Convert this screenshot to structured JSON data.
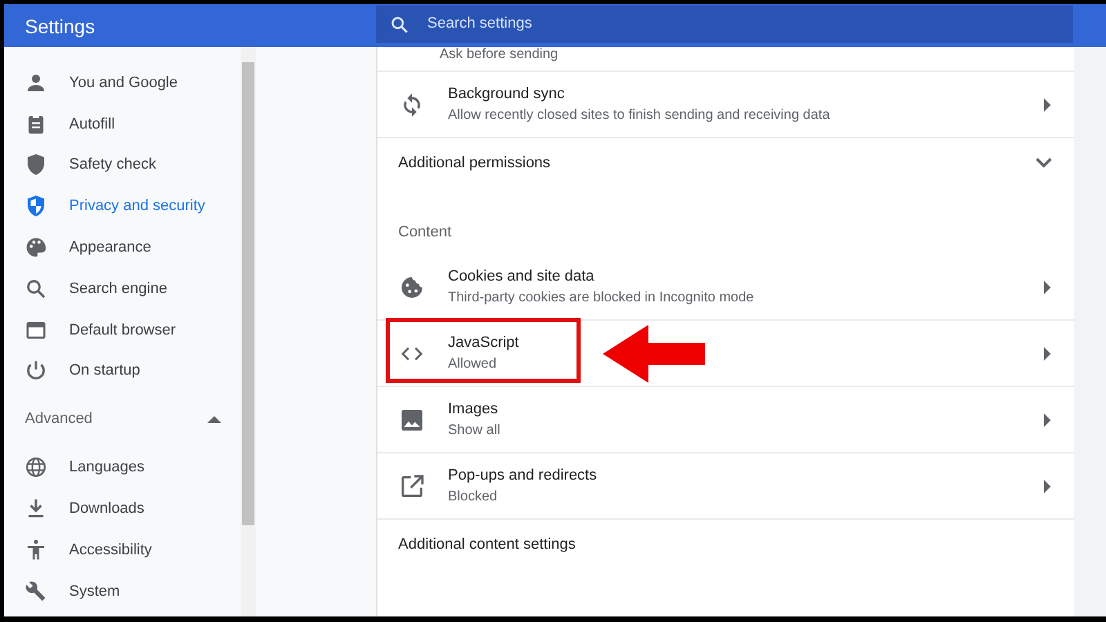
{
  "header": {
    "title": "Settings",
    "search": {
      "placeholder": "Search settings"
    }
  },
  "sidebar": {
    "items": [
      {
        "label": "You and Google",
        "selected": false
      },
      {
        "label": "Autofill",
        "selected": false
      },
      {
        "label": "Safety check",
        "selected": false
      },
      {
        "label": "Privacy and security",
        "selected": true
      },
      {
        "label": "Appearance",
        "selected": false
      },
      {
        "label": "Search engine",
        "selected": false
      },
      {
        "label": "Default browser",
        "selected": false
      },
      {
        "label": "On startup",
        "selected": false
      }
    ],
    "advanced": {
      "label": "Advanced",
      "expanded": true,
      "items": [
        {
          "label": "Languages",
          "selected": false
        },
        {
          "label": "Downloads",
          "selected": false
        },
        {
          "label": "Accessibility",
          "selected": false
        },
        {
          "label": "System",
          "selected": false
        }
      ]
    }
  },
  "main": {
    "rows": [
      {
        "kind": "subtext",
        "text": "Ask before sending"
      },
      {
        "kind": "item",
        "title": "Background sync",
        "subtitle": "Allow recently closed sites to finish sending and receiving data",
        "highlighted": false
      },
      {
        "kind": "expander",
        "title": "Additional permissions",
        "expanded": false
      },
      {
        "kind": "heading",
        "title": "Content"
      },
      {
        "kind": "item",
        "title": "Cookies and site data",
        "subtitle": "Third-party cookies are blocked in Incognito mode",
        "highlighted": false
      },
      {
        "kind": "item",
        "title": "JavaScript",
        "subtitle": "Allowed",
        "highlighted": true
      },
      {
        "kind": "item",
        "title": "Images",
        "subtitle": "Show all",
        "highlighted": false
      },
      {
        "kind": "item",
        "title": "Pop-ups and redirects",
        "subtitle": "Blocked",
        "highlighted": false
      },
      {
        "kind": "link",
        "title": "Additional content settings"
      }
    ]
  }
}
